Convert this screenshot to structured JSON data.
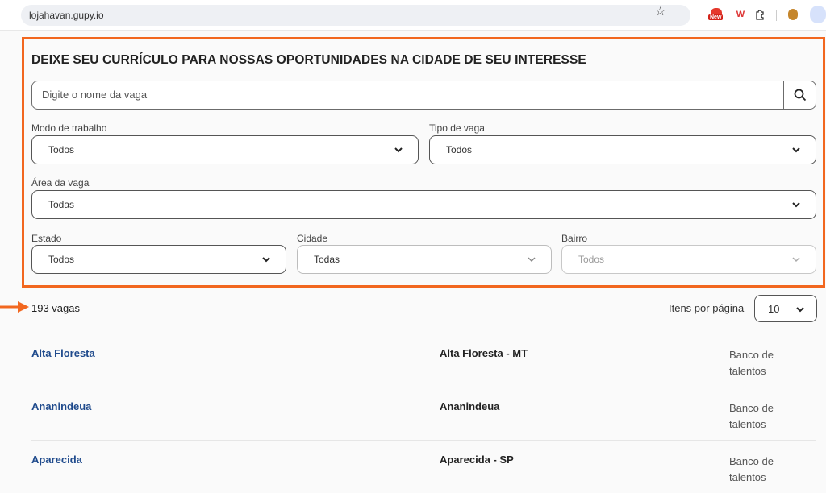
{
  "browser": {
    "url": "lojahavan.gupy.io",
    "extension_new_label": "New",
    "extension_w_label": "W"
  },
  "page": {
    "title": "DEIXE SEU CURRÍCULO PARA NOSSAS OPORTUNIDADES NA CIDADE DE SEU INTERESSE",
    "search": {
      "placeholder": "Digite o nome da vaga"
    },
    "filters": {
      "modo": {
        "label": "Modo de trabalho",
        "value": "Todos"
      },
      "tipo": {
        "label": "Tipo de vaga",
        "value": "Todos"
      },
      "area": {
        "label": "Área da vaga",
        "value": "Todas"
      },
      "estado": {
        "label": "Estado",
        "value": "Todos"
      },
      "cidade": {
        "label": "Cidade",
        "value": "Todas"
      },
      "bairro": {
        "label": "Bairro",
        "value": "Todos"
      }
    },
    "results": {
      "count": "193 vagas",
      "per_page_label": "Itens por página",
      "per_page_value": "10"
    },
    "jobs": [
      {
        "title": "Alta Floresta",
        "location": "Alta Floresta - MT",
        "type": "Banco de talentos"
      },
      {
        "title": "Ananindeua",
        "location": "Ananindeua",
        "type": "Banco de talentos"
      },
      {
        "title": "Aparecida",
        "location": "Aparecida - SP",
        "type": "Banco de talentos"
      }
    ]
  },
  "colors": {
    "highlight": "#f2671f",
    "link": "#1f4a8c"
  },
  "icons": [
    "star-icon",
    "search-icon",
    "chevron-down-icon",
    "puzzle-icon",
    "arrow-right-icon"
  ]
}
